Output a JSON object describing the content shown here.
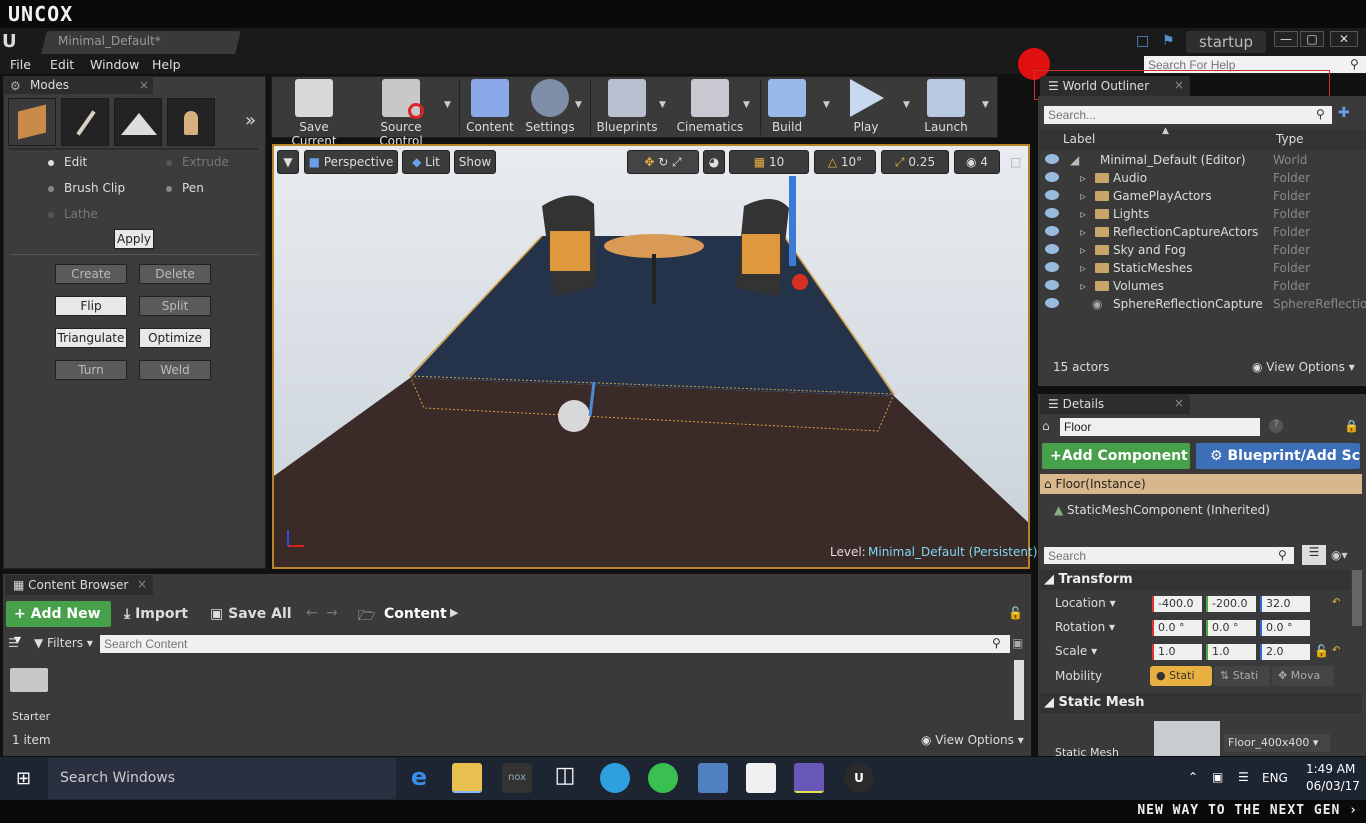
{
  "brand": "UNCOX",
  "slogan": "NEW WAY TO THE NEXT GEN ›",
  "window": {
    "doc_tab": "Minimal_Default*",
    "project": "startup",
    "min": "—",
    "max": "▢",
    "close": "✕"
  },
  "menu": [
    "File",
    "Edit",
    "Window",
    "Help"
  ],
  "help_search_placeholder": "Search For Help",
  "modes": {
    "tab": "Modes",
    "radios": [
      "Edit",
      "Extrude",
      "Brush Clip",
      "Pen",
      "Lathe"
    ],
    "apply": "Apply",
    "buttons": [
      "Create",
      "Delete",
      "Flip",
      "Split",
      "Triangulate",
      "Optimize",
      "Turn",
      "Weld"
    ]
  },
  "toolbar": [
    "Save Current",
    "Source Control",
    "Content",
    "Settings",
    "Blueprints",
    "Cinematics",
    "Build",
    "Play",
    "Launch"
  ],
  "viewport": {
    "perspective": "Perspective",
    "lit": "Lit",
    "show": "Show",
    "grid": "10",
    "angle": "10°",
    "scale": "0.25",
    "camera": "4",
    "level_label": "Level:",
    "level_name": "Minimal_Default (Persistent)"
  },
  "outliner": {
    "tab": "World Outliner",
    "search": "Search...",
    "col_label": "Label",
    "col_type": "Type",
    "rows": [
      {
        "name": "Minimal_Default (Editor)",
        "type": "World"
      },
      {
        "name": "Audio",
        "type": "Folder"
      },
      {
        "name": "GamePlayActors",
        "type": "Folder"
      },
      {
        "name": "Lights",
        "type": "Folder"
      },
      {
        "name": "ReflectionCaptureActors",
        "type": "Folder"
      },
      {
        "name": "Sky and Fog",
        "type": "Folder"
      },
      {
        "name": "StaticMeshes",
        "type": "Folder"
      },
      {
        "name": "Volumes",
        "type": "Folder"
      },
      {
        "name": "SphereReflectionCapture",
        "type": "SphereReflectio"
      }
    ],
    "count": "15 actors",
    "view_options": "View Options"
  },
  "details": {
    "tab": "Details",
    "name": "Floor",
    "add_component": "Add Component",
    "blueprint": "Blueprint/Add Scr",
    "instance": "Floor(Instance)",
    "component": "StaticMeshComponent (Inherited)",
    "search": "Search",
    "transform": "Transform",
    "location_label": "Location",
    "location": [
      "-400.0 cı",
      "-200.0 cı",
      "32.0 cm"
    ],
    "rotation_label": "Rotation",
    "rotation": [
      "0.0 °",
      "0.0 °",
      "0.0 °"
    ],
    "scale_label": "Scale",
    "scale": [
      "1.0",
      "1.0",
      "2.0"
    ],
    "mobility_label": "Mobility",
    "mobility": [
      "Stati",
      "Stati",
      "Mova"
    ],
    "static_mesh_header": "Static Mesh",
    "static_mesh_label": "Static Mesh",
    "static_mesh_value": "Floor_400x400"
  },
  "content_browser": {
    "tab": "Content Browser",
    "add_new": "Add New",
    "import": "Import",
    "save_all": "Save All",
    "path": "Content",
    "filters": "Filters",
    "search": "Search Content",
    "folder": "Starter",
    "count": "1 item",
    "view_options": "View Options"
  },
  "taskbar": {
    "search": "Search Windows",
    "lang": "ENG",
    "time": "1:49 AM",
    "date": "06/03/17"
  }
}
